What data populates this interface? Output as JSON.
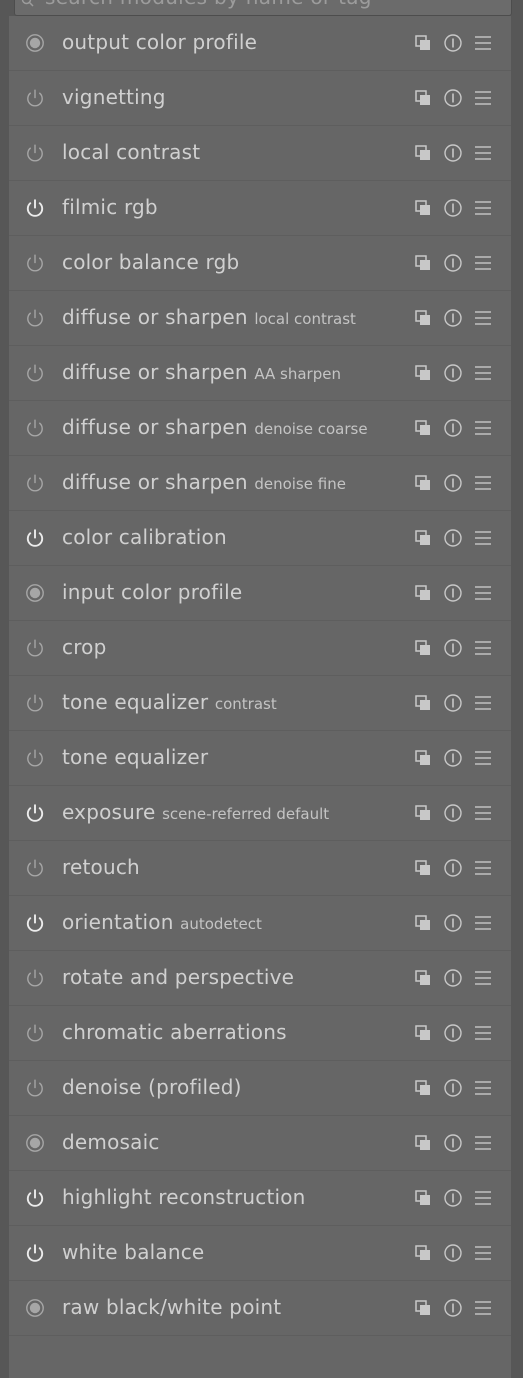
{
  "search": {
    "placeholder": "search modules by name or tag"
  },
  "modules": [
    {
      "name": "output color profile",
      "label": "",
      "state": "always-on"
    },
    {
      "name": "vignetting",
      "label": "",
      "state": "off"
    },
    {
      "name": "local contrast",
      "label": "",
      "state": "off"
    },
    {
      "name": "filmic rgb",
      "label": "",
      "state": "on"
    },
    {
      "name": "color balance rgb",
      "label": "",
      "state": "off"
    },
    {
      "name": "diffuse or sharpen",
      "label": "local contrast",
      "state": "off"
    },
    {
      "name": "diffuse or sharpen",
      "label": "AA sharpen",
      "state": "off"
    },
    {
      "name": "diffuse or sharpen",
      "label": "denoise coarse",
      "state": "off"
    },
    {
      "name": "diffuse or sharpen",
      "label": "denoise fine",
      "state": "off"
    },
    {
      "name": "color calibration",
      "label": "",
      "state": "on"
    },
    {
      "name": "input color profile",
      "label": "",
      "state": "always-on"
    },
    {
      "name": "crop",
      "label": "",
      "state": "off"
    },
    {
      "name": "tone equalizer",
      "label": "contrast",
      "state": "off"
    },
    {
      "name": "tone equalizer",
      "label": "",
      "state": "off"
    },
    {
      "name": "exposure",
      "label": "scene-referred default",
      "state": "on"
    },
    {
      "name": "retouch",
      "label": "",
      "state": "off"
    },
    {
      "name": "orientation",
      "label": "autodetect",
      "state": "on"
    },
    {
      "name": "rotate and perspective",
      "label": "",
      "state": "off"
    },
    {
      "name": "chromatic aberrations",
      "label": "",
      "state": "off"
    },
    {
      "name": "denoise (profiled)",
      "label": "",
      "state": "off"
    },
    {
      "name": "demosaic",
      "label": "",
      "state": "always-on"
    },
    {
      "name": "highlight reconstruction",
      "label": "",
      "state": "on"
    },
    {
      "name": "white balance",
      "label": "",
      "state": "on"
    },
    {
      "name": "raw black/white point",
      "label": "",
      "state": "always-on"
    }
  ],
  "colors": {
    "background": "#575757",
    "panel": "#666666",
    "text": "#d0d0d0",
    "icon_on": "#ececec",
    "icon_off": "#a6a6a6",
    "icon_action": "#c8c8c8"
  },
  "icons": {
    "search": "magnifier-icon",
    "state_on": "power-on-icon",
    "state_off": "power-off-icon",
    "state_always_on": "always-on-icon",
    "presets": "presets-icon",
    "reset": "reset-icon",
    "menu": "hamburger-menu-icon"
  }
}
